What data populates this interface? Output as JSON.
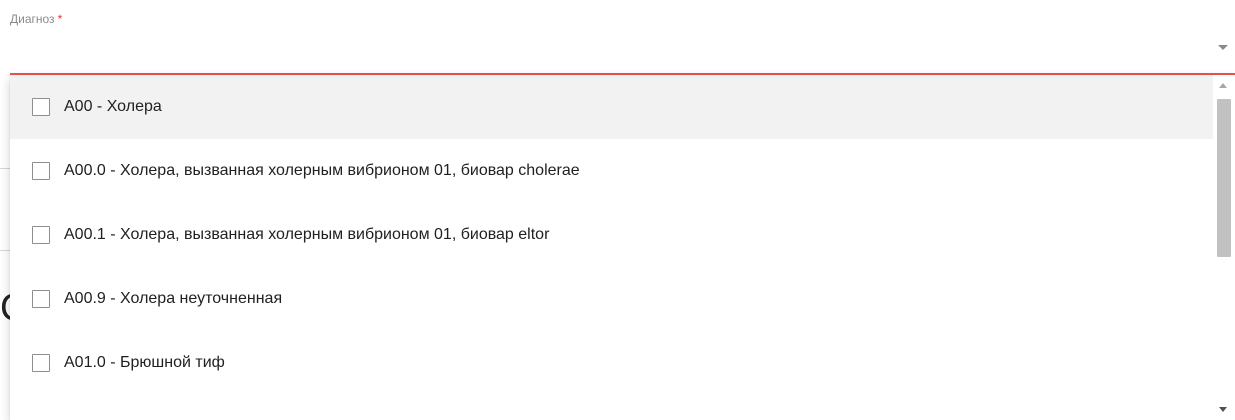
{
  "field": {
    "label": "Диагноз",
    "required_mark": "*",
    "value": "",
    "accent_color": "#ef5350"
  },
  "background": {
    "partial_glyph": "С"
  },
  "dropdown": {
    "hovered_index": 0,
    "options": [
      {
        "label": "A00 - Холера",
        "checked": false
      },
      {
        "label": "A00.0 - Холера, вызванная холерным вибрионом 01, биовар cholerae",
        "checked": false
      },
      {
        "label": "A00.1 - Холера, вызванная холерным вибрионом 01, биовар eltor",
        "checked": false
      },
      {
        "label": "A00.9 - Холера неуточненная",
        "checked": false
      },
      {
        "label": "A01.0 - Брюшной тиф",
        "checked": false
      }
    ]
  },
  "icons": {
    "dropdown_arrow": "chevron-down-icon",
    "scroll_up": "scroll-up-arrow-icon",
    "scroll_down": "scroll-down-arrow-icon"
  }
}
